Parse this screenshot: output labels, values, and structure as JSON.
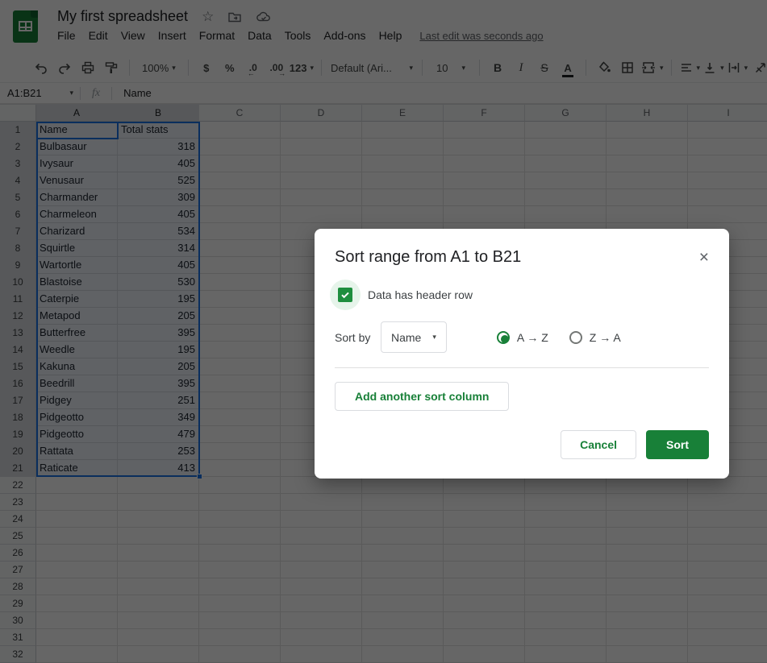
{
  "app": {
    "title": "My first spreadsheet",
    "menu": [
      "File",
      "Edit",
      "View",
      "Insert",
      "Format",
      "Data",
      "Tools",
      "Add-ons",
      "Help"
    ],
    "last_edit": "Last edit was seconds ago",
    "logo_color": "#188038"
  },
  "toolbar": {
    "zoom": "100%",
    "currency": "$",
    "percent": "%",
    "decrease_decimal": ".0",
    "increase_decimal": ".00",
    "more_formats": "123",
    "font_name": "Default (Ari...",
    "font_size": "10",
    "bold": "B",
    "italic": "I",
    "strikethrough": "S",
    "text_color": "A"
  },
  "formula_bar": {
    "name_box": "A1:B21",
    "fx": "fx",
    "content": "Name"
  },
  "grid": {
    "columns": [
      "A",
      "B",
      "C",
      "D",
      "E",
      "F",
      "G",
      "H",
      "I"
    ],
    "selected_columns": [
      "A",
      "B"
    ],
    "visible_rows": 32,
    "selected_row_start": 1,
    "selected_row_end": 21,
    "selection_color": "#1a73e8"
  },
  "sheet": {
    "header": [
      "Name",
      "Total stats"
    ],
    "rows": [
      [
        "Bulbasaur",
        "318"
      ],
      [
        "Ivysaur",
        "405"
      ],
      [
        "Venusaur",
        "525"
      ],
      [
        "Charmander",
        "309"
      ],
      [
        "Charmeleon",
        "405"
      ],
      [
        "Charizard",
        "534"
      ],
      [
        "Squirtle",
        "314"
      ],
      [
        "Wartortle",
        "405"
      ],
      [
        "Blastoise",
        "530"
      ],
      [
        "Caterpie",
        "195"
      ],
      [
        "Metapod",
        "205"
      ],
      [
        "Butterfree",
        "395"
      ],
      [
        "Weedle",
        "195"
      ],
      [
        "Kakuna",
        "205"
      ],
      [
        "Beedrill",
        "395"
      ],
      [
        "Pidgey",
        "251"
      ],
      [
        "Pidgeotto",
        "349"
      ],
      [
        "Pidgeotto",
        "479"
      ],
      [
        "Rattata",
        "253"
      ],
      [
        "Raticate",
        "413"
      ]
    ]
  },
  "dialog": {
    "title": "Sort range from A1 to B21",
    "close": "×",
    "checkbox_label": "Data has header row",
    "checkbox_checked": true,
    "sort_by_label": "Sort by",
    "sort_key": "Name",
    "radio_az": "A → Z",
    "radio_za": "Z → A",
    "radio_selected": "A → Z",
    "add_button": "Add another sort column",
    "cancel_button": "Cancel",
    "sort_button": "Sort",
    "accent_green": "#188038",
    "checkbox_green": "#1e8e3e"
  }
}
